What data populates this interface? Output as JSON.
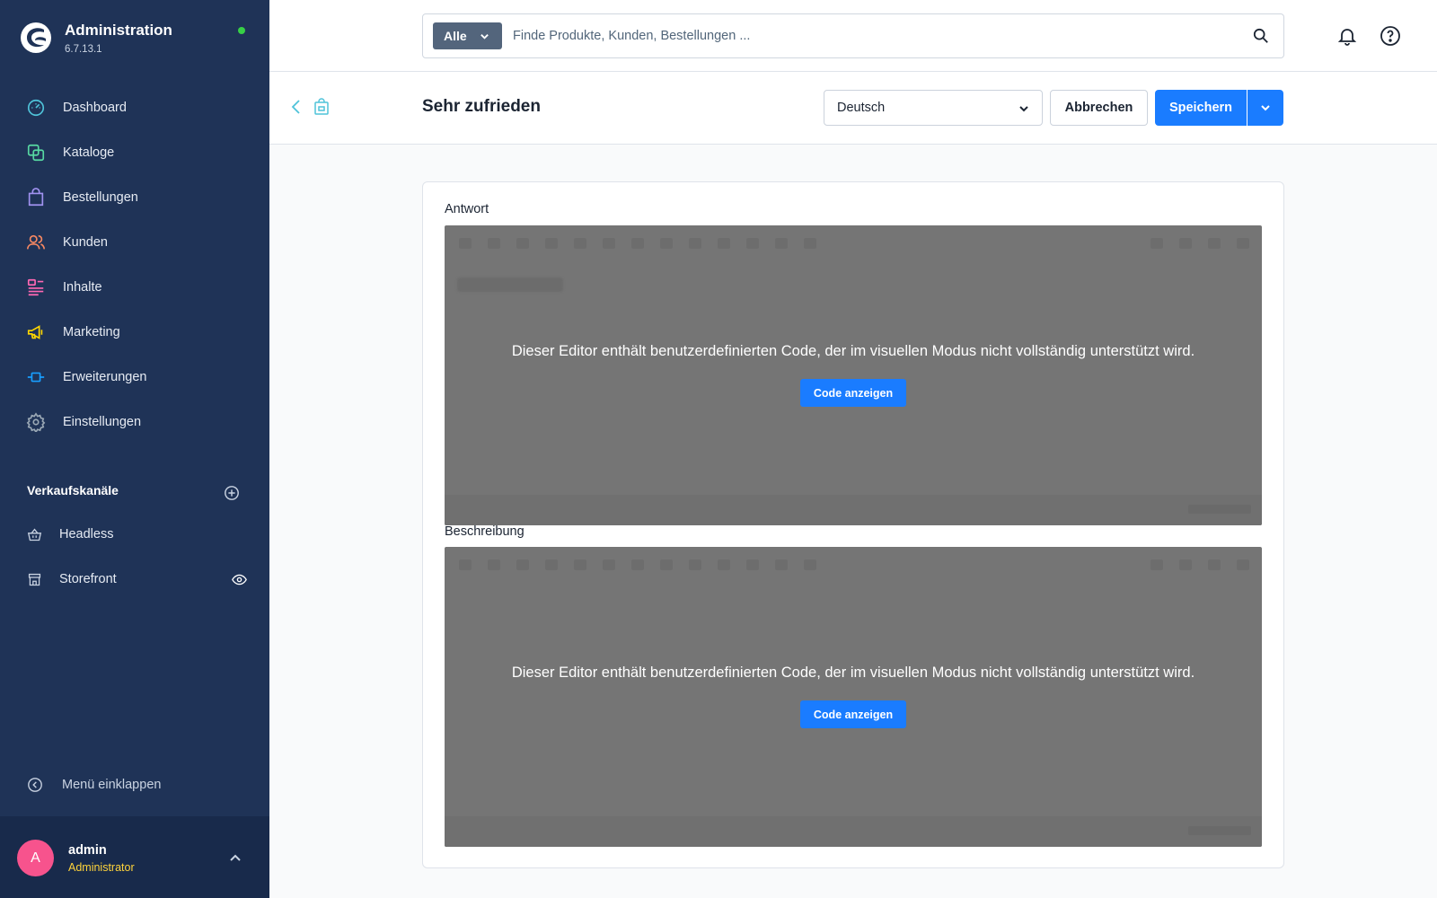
{
  "app": {
    "title": "Administration",
    "version": "6.7.13.1",
    "online_color": "#37d046"
  },
  "sidebar": {
    "items": [
      {
        "label": "Dashboard",
        "icon": "dashboard-icon",
        "color": "#4fc3d9"
      },
      {
        "label": "Kataloge",
        "icon": "catalog-icon",
        "color": "#57d9a3"
      },
      {
        "label": "Bestellungen",
        "icon": "shopping-bag-icon",
        "color": "#a092f0"
      },
      {
        "label": "Kunden",
        "icon": "users-icon",
        "color": "#f88962"
      },
      {
        "label": "Inhalte",
        "icon": "content-icon",
        "color": "#ff68b4"
      },
      {
        "label": "Marketing",
        "icon": "megaphone-icon",
        "color": "#ffd700"
      },
      {
        "label": "Erweiterungen",
        "icon": "plug-icon",
        "color": "#189eff"
      },
      {
        "label": "Einstellungen",
        "icon": "gear-icon",
        "color": "#9aa8b5"
      }
    ],
    "channels_title": "Verkaufskanäle",
    "channels": [
      {
        "label": "Headless",
        "icon": "basket-icon"
      },
      {
        "label": "Storefront",
        "icon": "storefront-icon"
      }
    ],
    "collapse_label": "Menü einklappen"
  },
  "user": {
    "initial": "A",
    "name": "admin",
    "role": "Administrator"
  },
  "search": {
    "type_label": "Alle",
    "placeholder": "Finde Produkte, Kunden, Bestellungen ..."
  },
  "smartbar": {
    "title": "Sehr zufrieden",
    "language": "Deutsch",
    "cancel_label": "Abbrechen",
    "save_label": "Speichern"
  },
  "fields": [
    {
      "label": "Antwort",
      "message": "Dieser Editor enthält benutzerdefinierten Code, der im visuellen Modus nicht vollständig unterstützt wird.",
      "button_label": "Code anzeigen"
    },
    {
      "label": "Beschreibung",
      "message": "Dieser Editor enthält benutzerdefinierten Code, der im visuellen Modus nicht vollständig unterstützt wird.",
      "button_label": "Code anzeigen"
    }
  ],
  "colors": {
    "sidebar_bg": "#1f3357",
    "primary": "#1a7cff",
    "role": "#ffd43b",
    "avatar": "#f7538d"
  }
}
